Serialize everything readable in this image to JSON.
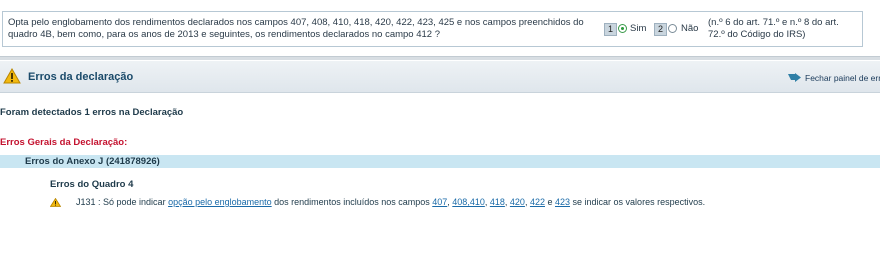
{
  "question": {
    "text": "Opta pelo englobamento dos rendimentos declarados nos campos 407, 408, 410, 418, 420, 422, 423, 425 e nos campos preenchidos do quadro 4B, bem como, para os anos de 2013 e seguintes, os rendimentos declarados no campo 412 ?",
    "options": [
      {
        "num": "1",
        "label": "Sim",
        "selected": true
      },
      {
        "num": "2",
        "label": "Não",
        "selected": false
      }
    ],
    "reference": "(n.º 6 do art. 71.º e n.º 8 do art. 72.º do Código do IRS)"
  },
  "errors_panel": {
    "title": "Erros da declaração",
    "close_label": "Fechar painel de erros",
    "detected_text": "Foram detectados 1 erros na Declaração",
    "general_heading": "Erros Gerais da Declaração:",
    "annex_heading": "Erros do Anexo J (241878926)",
    "quadro_heading": "Erros do Quadro 4",
    "error": {
      "code_prefix": "J131 : Só pode indicar ",
      "link_option": "opção pelo englobamento",
      "mid_text": " dos rendimentos incluídos nos campos ",
      "field_links": [
        "407",
        "408,410",
        "418",
        "420",
        "422"
      ],
      "and_text": " e ",
      "last_link": "423",
      "tail_text": " se indicar os valores respectivos."
    }
  },
  "colors": {
    "accent": "#1a4a6a",
    "error_red": "#c4122f",
    "annex_bar": "#c9e6f2",
    "link": "#1a6aa8"
  },
  "icons": [
    "warning-icon",
    "close-panel-icon",
    "radio-selected-icon"
  ]
}
